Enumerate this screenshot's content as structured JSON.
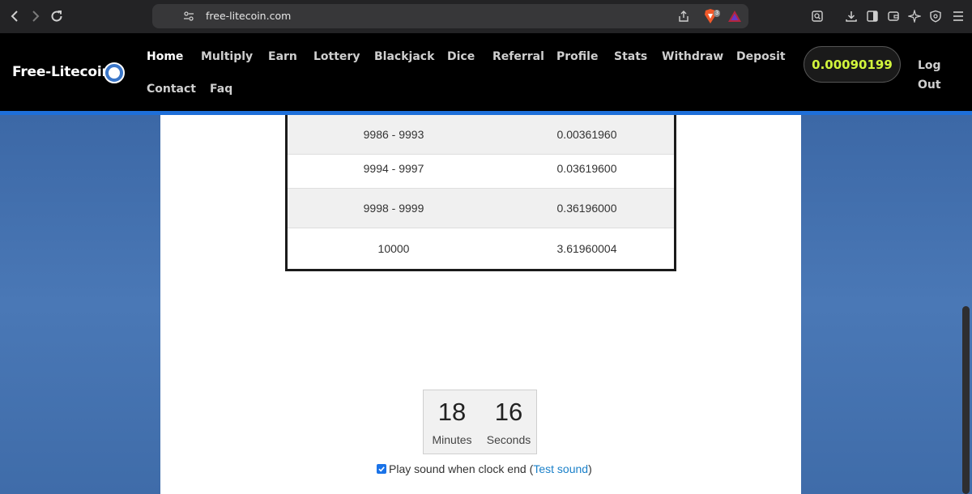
{
  "browser": {
    "url": "free-litecoin.com",
    "brave_shield_count": "3"
  },
  "site": {
    "brand": "Free-Litecoin",
    "nav": [
      {
        "label": "Home",
        "active": true
      },
      {
        "label": "Multiply"
      },
      {
        "label": "Earn"
      },
      {
        "label": "Lottery"
      },
      {
        "label": "Blackjack"
      },
      {
        "label": "Dice"
      },
      {
        "label": "Referral"
      },
      {
        "label": "Profile"
      },
      {
        "label": "Stats"
      },
      {
        "label": "Withdraw"
      },
      {
        "label": "Deposit"
      },
      {
        "label": "Contact"
      },
      {
        "label": "Faq"
      }
    ],
    "balance": "0.00090199",
    "logout_line1": "Log",
    "logout_line2": "Out"
  },
  "prize_table": {
    "rows": [
      {
        "range": "9986 - 9993",
        "amount": "0.00361960"
      },
      {
        "range": "9994 - 9997",
        "amount": "0.03619600"
      },
      {
        "range": "9998 - 9999",
        "amount": "0.36196000"
      },
      {
        "range": "10000",
        "amount": "3.61960004"
      }
    ]
  },
  "timer": {
    "minutes_value": "18",
    "minutes_label": "Minutes",
    "seconds_value": "16",
    "seconds_label": "Seconds"
  },
  "sound": {
    "checked": true,
    "label": "Play sound when clock end",
    "paren_open": "(",
    "link": "Test sound",
    "paren_close": ")"
  },
  "colors": {
    "header_bg": "#000000",
    "header_rule": "#1e6fd9",
    "balance_text": "#d2f53c",
    "page_bg": "#3e6aa8",
    "link": "#1a80c9"
  }
}
